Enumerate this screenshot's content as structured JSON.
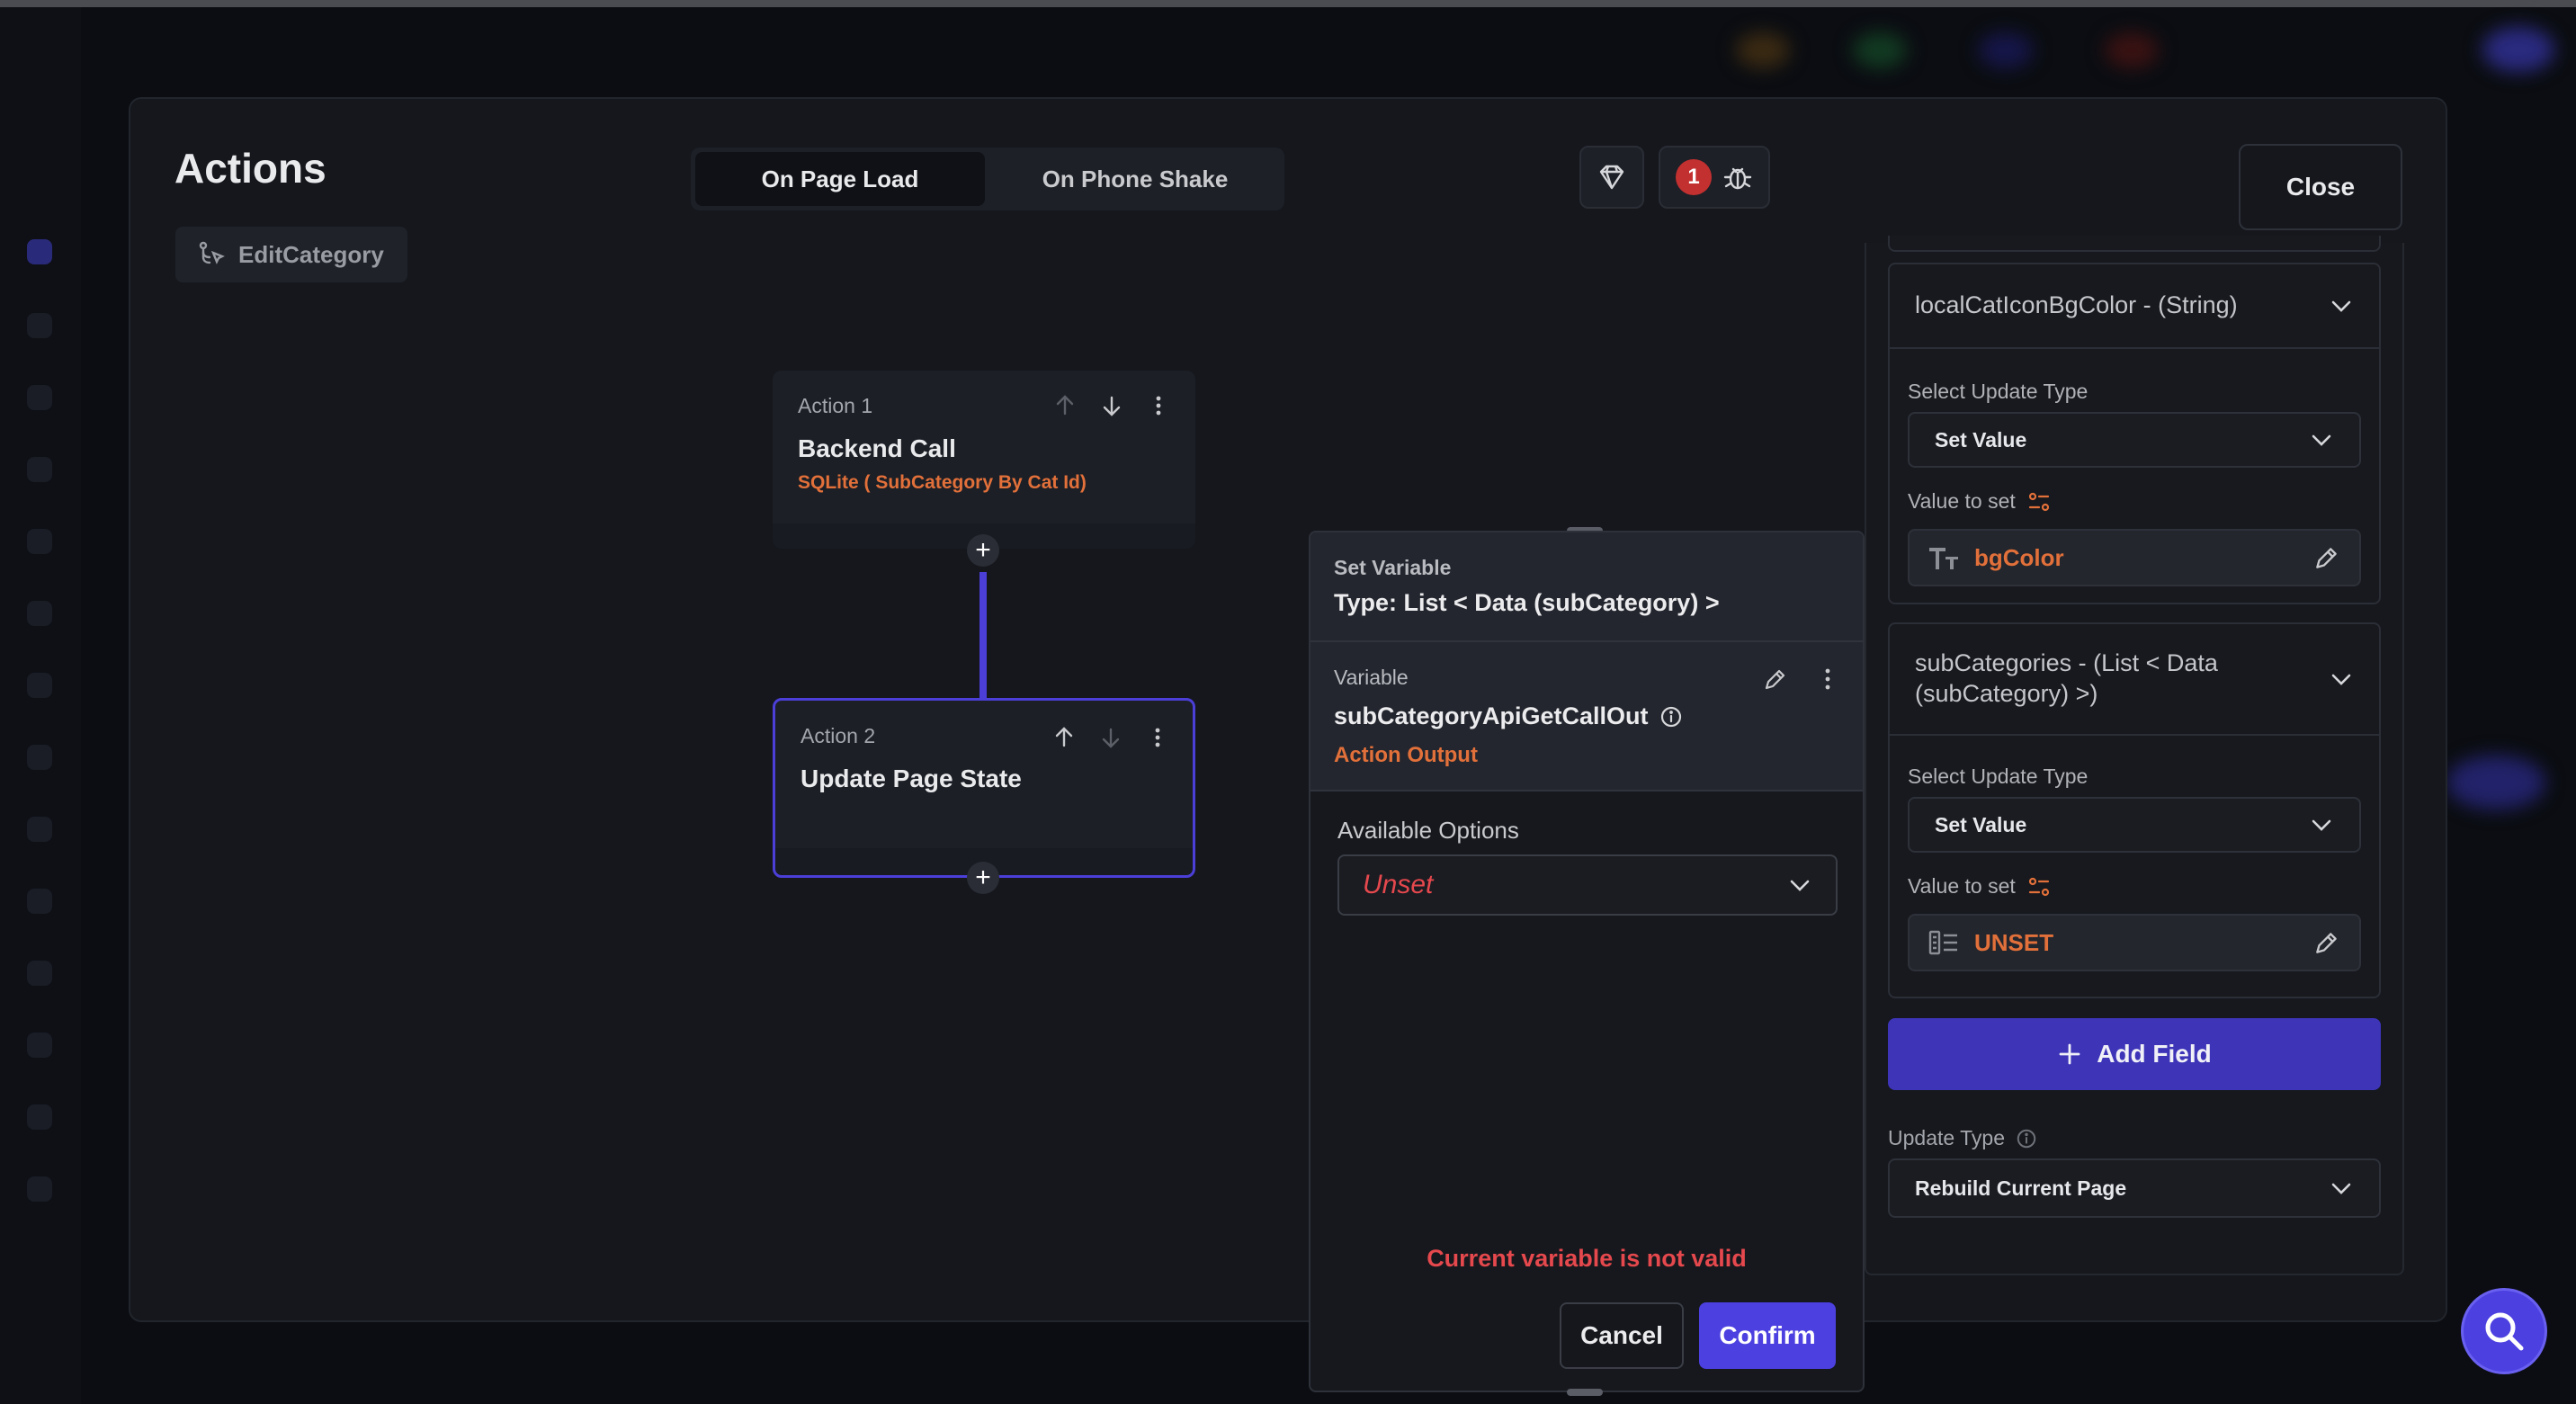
{
  "modal": {
    "title": "Actions",
    "chip_label": "EditCategory",
    "tabs": [
      {
        "label": "On Page Load",
        "active": true
      },
      {
        "label": "On Phone Shake",
        "active": false
      }
    ],
    "error_count": "1",
    "close_label": "Close"
  },
  "actions": [
    {
      "index_label": "Action 1",
      "title": "Backend Call",
      "subtitle": "SQLite ( SubCategory By Cat Id)"
    },
    {
      "index_label": "Action 2",
      "title": "Update Page State",
      "subtitle": ""
    }
  ],
  "set_variable": {
    "heading": "Set Variable",
    "type_text": "Type: List < Data (subCategory) >",
    "variable_label": "Variable",
    "variable_name": "subCategoryApiGetCallOut",
    "variable_source": "Action Output",
    "available_label": "Available Options",
    "available_value": "Unset",
    "error_text": "Current variable is not valid",
    "cancel_label": "Cancel",
    "confirm_label": "Confirm"
  },
  "right_panel": {
    "fields": [
      {
        "name": "localCatIconBgColor - (String)",
        "update_type_label": "Select Update Type",
        "update_type_value": "Set Value",
        "value_label": "Value to set",
        "value": "bgColor"
      },
      {
        "name": "subCategories - (List < Data (subCategory) >)",
        "update_type_label": "Select Update Type",
        "update_type_value": "Set Value",
        "value_label": "Value to set",
        "value": "UNSET"
      }
    ],
    "add_field_label": "Add Field",
    "update_type_label": "Update Type",
    "update_type_value": "Rebuild Current Page"
  },
  "colors": {
    "accent": "#4c40e0",
    "warning_orange": "#e2703a",
    "error_red": "#e5484d"
  }
}
